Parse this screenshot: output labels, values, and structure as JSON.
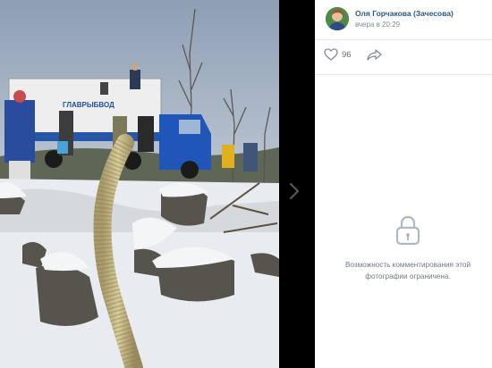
{
  "author": {
    "name": "Оля Горчакова (Зачесова)",
    "time": "вчера в 20:29"
  },
  "actions": {
    "likes_count": "96",
    "like_icon": "heart-outline-icon",
    "share_icon": "share-arrow-icon"
  },
  "photo": {
    "truck_sign": "ГЛАВРЫБВОД"
  },
  "comments": {
    "lock_icon": "lock-icon",
    "restricted_text": "Возможность комментирования этой фотографии ограничена."
  },
  "colors": {
    "link": "#2a5885",
    "muted": "#818c99",
    "viewer_bg": "#000000"
  }
}
